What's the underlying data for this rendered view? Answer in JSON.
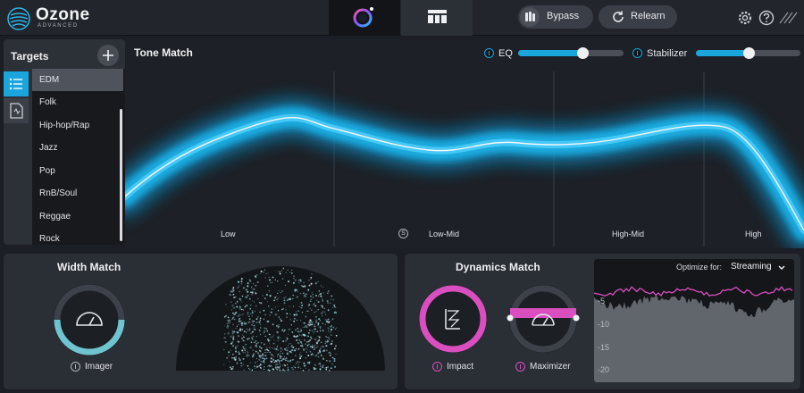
{
  "app": {
    "name": "Ozone",
    "edition": "ADVANCED"
  },
  "toolbar": {
    "bypass_label": "Bypass",
    "relearn_label": "Relearn"
  },
  "targets": {
    "title": "Targets",
    "items": [
      "EDM",
      "Folk",
      "Hip-hop/Rap",
      "Jazz",
      "Pop",
      "RnB/Soul",
      "Reggae",
      "Rock"
    ],
    "selected": "EDM"
  },
  "tone_match": {
    "title": "Tone Match",
    "eq_label": "EQ",
    "eq_level": 0.61,
    "stabilizer_label": "Stabilizer",
    "stabilizer_level": 0.5,
    "bands": [
      "Low",
      "Low-Mid",
      "High-Mid",
      "High"
    ],
    "solo_symbol": "S"
  },
  "width_match": {
    "title": "Width Match",
    "imager_label": "Imager"
  },
  "dynamics_match": {
    "title": "Dynamics Match",
    "impact_label": "Impact",
    "maximizer_label": "Maximizer",
    "optimize_label": "Optimize for:",
    "optimize_value": "Streaming",
    "meter_ticks": [
      "-5",
      "-10",
      "-15",
      "-20"
    ]
  },
  "colors": {
    "accent_blue": "#1aa6dc",
    "accent_pink": "#d94fc0",
    "imager_teal": "#6fc4cf"
  }
}
